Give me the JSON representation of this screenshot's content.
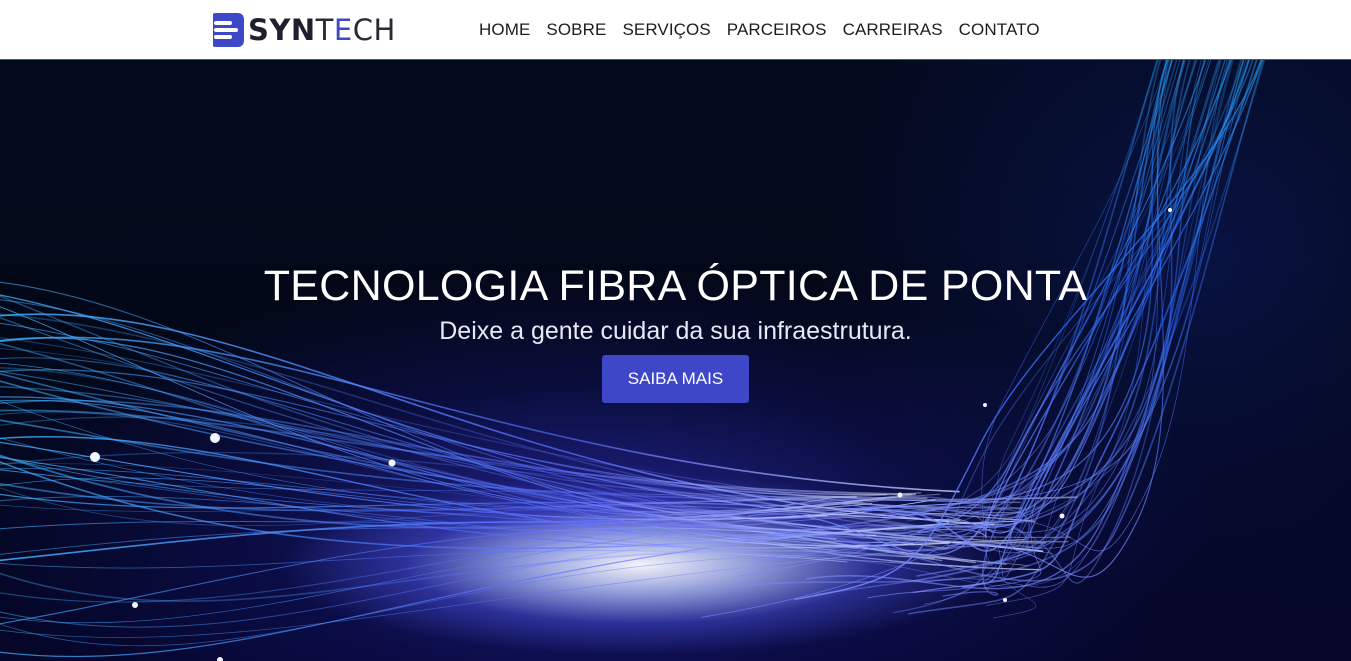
{
  "header": {
    "logo": {
      "part_bold": "SYN",
      "part_thin_1": "T",
      "part_accent": "E",
      "part_thin_2": "CH",
      "mark_icon": "stacked-bars-logo-icon"
    },
    "nav": [
      {
        "label": "HOME"
      },
      {
        "label": "SOBRE"
      },
      {
        "label": "SERVIÇOS"
      },
      {
        "label": "PARCEIROS"
      },
      {
        "label": "CARREIRAS"
      },
      {
        "label": "CONTATO"
      }
    ]
  },
  "hero": {
    "title": "TECNOLOGIA FIBRA ÓPTICA DE PONTA",
    "subtitle": "Deixe a gente cuidar da sua infraestrutura.",
    "cta_label": "SAIBA MAIS",
    "background": "fiber-optic-light-strands-image"
  },
  "colors": {
    "accent": "#3f47c9",
    "nav_text": "#1d1d1d",
    "hero_text": "#ffffff",
    "header_bg": "#ffffff"
  }
}
